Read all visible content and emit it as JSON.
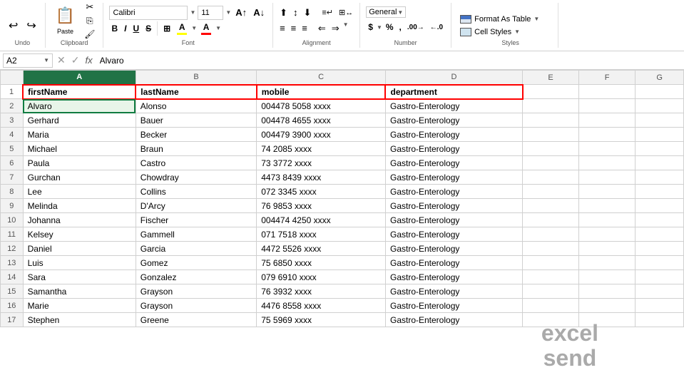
{
  "toolbar": {
    "undo_label": "Undo",
    "clipboard_label": "Clipboard",
    "paste_label": "Paste",
    "font_label": "Font",
    "font_name": "Calibri",
    "font_size": "11",
    "alignment_label": "Alignment",
    "number_label": "Number",
    "styles_label": "Styles",
    "format_as_table": "Format As Table",
    "cell_styles": "Cell Styles",
    "bold": "B",
    "italic": "I",
    "underline": "U"
  },
  "formula_bar": {
    "cell_ref": "A2",
    "formula": "Alvaro"
  },
  "columns": [
    "",
    "A",
    "B",
    "C",
    "D",
    "E",
    "F",
    "G"
  ],
  "headers": {
    "row_num": 1,
    "firstName": "firstName",
    "lastName": "lastName",
    "mobile": "mobile",
    "department": "department"
  },
  "rows": [
    {
      "num": 2,
      "firstName": "Alvaro",
      "lastName": "Alonso",
      "mobile": "004478 5058 xxxx",
      "department": "Gastro-Enterology"
    },
    {
      "num": 3,
      "firstName": "Gerhard",
      "lastName": "Bauer",
      "mobile": "004478 4655 xxxx",
      "department": "Gastro-Enterology"
    },
    {
      "num": 4,
      "firstName": "Maria",
      "lastName": "Becker",
      "mobile": "004479 3900 xxxx",
      "department": "Gastro-Enterology"
    },
    {
      "num": 5,
      "firstName": "Michael",
      "lastName": "Braun",
      "mobile": "74 2085 xxxx",
      "department": "Gastro-Enterology"
    },
    {
      "num": 6,
      "firstName": "Paula",
      "lastName": "Castro",
      "mobile": "73 3772 xxxx",
      "department": "Gastro-Enterology"
    },
    {
      "num": 7,
      "firstName": "Gurchan",
      "lastName": "Chowdray",
      "mobile": "4473 8439 xxxx",
      "department": "Gastro-Enterology"
    },
    {
      "num": 8,
      "firstName": "Lee",
      "lastName": "Collins",
      "mobile": "072 3345 xxxx",
      "department": "Gastro-Enterology"
    },
    {
      "num": 9,
      "firstName": "Melinda",
      "lastName": "D'Arcy",
      "mobile": "76 9853 xxxx",
      "department": "Gastro-Enterology"
    },
    {
      "num": 10,
      "firstName": "Johanna",
      "lastName": "Fischer",
      "mobile": "004474 4250 xxxx",
      "department": "Gastro-Enterology"
    },
    {
      "num": 11,
      "firstName": "Kelsey",
      "lastName": "Gammell",
      "mobile": "071 7518 xxxx",
      "department": "Gastro-Enterology"
    },
    {
      "num": 12,
      "firstName": "Daniel",
      "lastName": "Garcia",
      "mobile": "4472 5526 xxxx",
      "department": "Gastro-Enterology"
    },
    {
      "num": 13,
      "firstName": "Luis",
      "lastName": "Gomez",
      "mobile": "75 6850 xxxx",
      "department": "Gastro-Enterology"
    },
    {
      "num": 14,
      "firstName": "Sara",
      "lastName": "Gonzalez",
      "mobile": "079 6910 xxxx",
      "department": "Gastro-Enterology"
    },
    {
      "num": 15,
      "firstName": "Samantha",
      "lastName": "Grayson",
      "mobile": "76 3932 xxxx",
      "department": "Gastro-Enterology"
    },
    {
      "num": 16,
      "firstName": "Marie",
      "lastName": "Grayson",
      "mobile": "4476 8558 xxxx",
      "department": "Gastro-Enterology"
    },
    {
      "num": 17,
      "firstName": "Stephen",
      "lastName": "Greene",
      "mobile": "75 5969 xxxx",
      "department": "Gastro-Enterology"
    }
  ],
  "watermark": {
    "line1": "excel",
    "line2": "send"
  }
}
